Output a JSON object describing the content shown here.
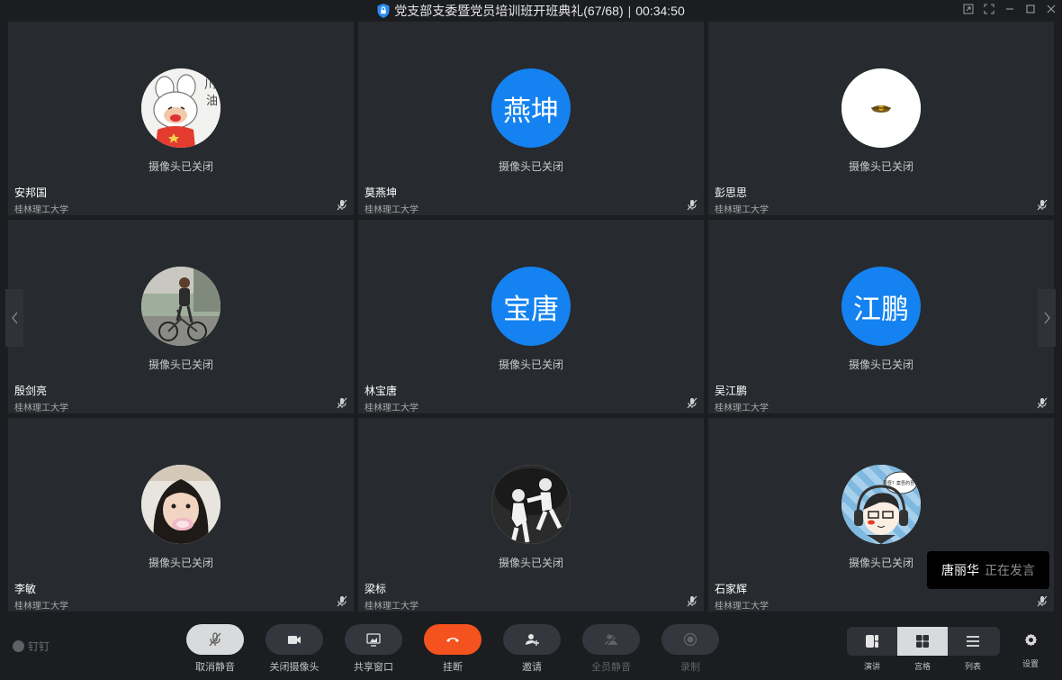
{
  "window": {
    "title": "党支部支委暨党员培训班开班典礼(67/68)",
    "separator": "|",
    "duration": "00:34:50"
  },
  "participants": [
    {
      "name": "安邦国",
      "org": "桂林理工大学",
      "status": "摄像头已关闭",
      "avatar": "cartoon-rabbit-image",
      "mic": "muted"
    },
    {
      "name": "莫燕坤",
      "org": "桂林理工大学",
      "status": "摄像头已关闭",
      "avatar_text": "燕坤",
      "mic": "muted"
    },
    {
      "name": "彭思思",
      "org": "桂林理工大学",
      "status": "摄像头已关闭",
      "avatar": "small-emblem-image",
      "mic": "muted"
    },
    {
      "name": "殷剑亮",
      "org": "桂林理工大学",
      "status": "摄像头已关闭",
      "avatar": "cyclist-photo",
      "mic": "muted"
    },
    {
      "name": "林宝唐",
      "org": "桂林理工大学",
      "status": "摄像头已关闭",
      "avatar_text": "宝唐",
      "mic": "muted"
    },
    {
      "name": "吴江鹏",
      "org": "桂林理工大学",
      "status": "摄像头已关闭",
      "avatar_text": "江鹏",
      "mic": "muted"
    },
    {
      "name": "李敏",
      "org": "桂林理工大学",
      "status": "摄像头已关闭",
      "avatar": "girl-photo",
      "mic": "muted"
    },
    {
      "name": "梁标",
      "org": "桂林理工大学",
      "status": "摄像头已关闭",
      "avatar": "boxing-illustration",
      "mic": "muted"
    },
    {
      "name": "石家辉",
      "org": "桂林理工大学",
      "status": "摄像头已关闭",
      "avatar": "cartoon-headphones-image",
      "avatar_bubble": "周吾？案吾的吾？",
      "mic": "muted"
    }
  ],
  "speaking": {
    "who": "唐丽华",
    "what": "正在发言"
  },
  "toolbar": {
    "brand": "钉钉",
    "buttons": [
      {
        "label": "取消静音",
        "icon": "mic-muted-icon",
        "state": "active"
      },
      {
        "label": "关闭摄像头",
        "icon": "camera-icon",
        "state": "normal"
      },
      {
        "label": "共享窗口",
        "icon": "share-screen-icon",
        "state": "normal"
      },
      {
        "label": "挂断",
        "icon": "hangup-icon",
        "state": "danger"
      },
      {
        "label": "邀请",
        "icon": "invite-icon",
        "state": "normal"
      },
      {
        "label": "全员静音",
        "icon": "mute-all-icon",
        "state": "disabled"
      },
      {
        "label": "录制",
        "icon": "record-icon",
        "state": "disabled"
      }
    ],
    "views": [
      {
        "label": "演讲",
        "icon": "speaker-view-icon"
      },
      {
        "label": "宫格",
        "icon": "grid-view-icon",
        "selected": true
      },
      {
        "label": "列表",
        "icon": "list-view-icon"
      }
    ],
    "settings_label": "设置"
  },
  "colors": {
    "accent": "#1482f0",
    "hangup": "#f4521e",
    "tile": "#272a2f"
  }
}
